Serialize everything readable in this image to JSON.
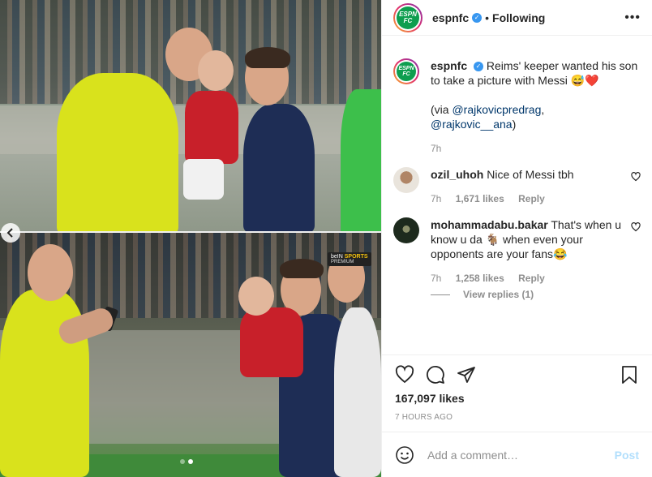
{
  "media": {
    "broadcast_logo": {
      "brand": "beIN",
      "channel": "SPORTS",
      "tier": "PREMIUM"
    },
    "carousel": {
      "total": 2,
      "active": 2
    },
    "prev_icon": "chevron-left-icon"
  },
  "header": {
    "avatar_text_line1": "ESPN",
    "avatar_text_line2": "FC",
    "username": "espnfc",
    "separator": "•",
    "follow_status": "Following",
    "more_icon": "more-horizontal-icon"
  },
  "caption": {
    "username": "espnfc",
    "text": "Reims' keeper wanted his son to take a picture with Messi 😅❤️",
    "via_prefix": "(via ",
    "mention1": "@rajkovicpredrag",
    "comma": ",",
    "mention2": "@rajkovic__ana",
    "suffix": ")",
    "time": "7h"
  },
  "comments": [
    {
      "username": "ozil_uhoh",
      "text": "Nice of Messi tbh",
      "time": "7h",
      "likes": "1,671 likes",
      "reply": "Reply"
    },
    {
      "username": "mohammadabu.bakar",
      "text": "That's when u know u da 🐐 when even your opponents are your fans😂",
      "time": "7h",
      "likes": "1,258 likes",
      "reply": "Reply",
      "view_replies": "View replies (1)"
    }
  ],
  "actions": {
    "like_icon": "heart-icon",
    "comment_icon": "comment-icon",
    "share_icon": "share-icon",
    "save_icon": "bookmark-icon"
  },
  "likes": "167,097 likes",
  "posted": "7 HOURS AGO",
  "add_comment": {
    "emoji_icon": "emoji-icon",
    "placeholder": "Add a comment…",
    "post_label": "Post"
  },
  "colors": {
    "verified": "#3897f0",
    "espn_green": "#0e9e4f",
    "post_disabled": "#b2dffc",
    "mention": "#00376b"
  }
}
